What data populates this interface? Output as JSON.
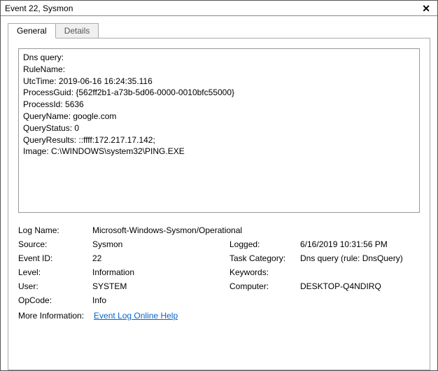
{
  "title": "Event 22, Sysmon",
  "tabs": {
    "general": "General",
    "details": "Details"
  },
  "eventText": "Dns query:\nRuleName:\nUtcTime: 2019-06-16 16:24:35.116\nProcessGuid: {562ff2b1-a73b-5d06-0000-0010bfc55000}\nProcessId: 5636\nQueryName: google.com\nQueryStatus: 0\nQueryResults: ::ffff:172.217.17.142;\nImage: C:\\WINDOWS\\system32\\PING.EXE",
  "labels": {
    "logName": "Log Name:",
    "source": "Source:",
    "logged": "Logged:",
    "eventId": "Event ID:",
    "taskCategory": "Task Category:",
    "level": "Level:",
    "keywords": "Keywords:",
    "user": "User:",
    "computer": "Computer:",
    "opCode": "OpCode:",
    "moreInfo": "More Information:"
  },
  "values": {
    "logName": "Microsoft-Windows-Sysmon/Operational",
    "source": "Sysmon",
    "logged": "6/16/2019 10:31:56 PM",
    "eventId": "22",
    "taskCategory": "Dns query (rule: DnsQuery)",
    "level": "Information",
    "keywords": "",
    "user": "SYSTEM",
    "computer": "DESKTOP-Q4NDIRQ",
    "opCode": "Info"
  },
  "moreInfoLink": "Event Log Online Help"
}
